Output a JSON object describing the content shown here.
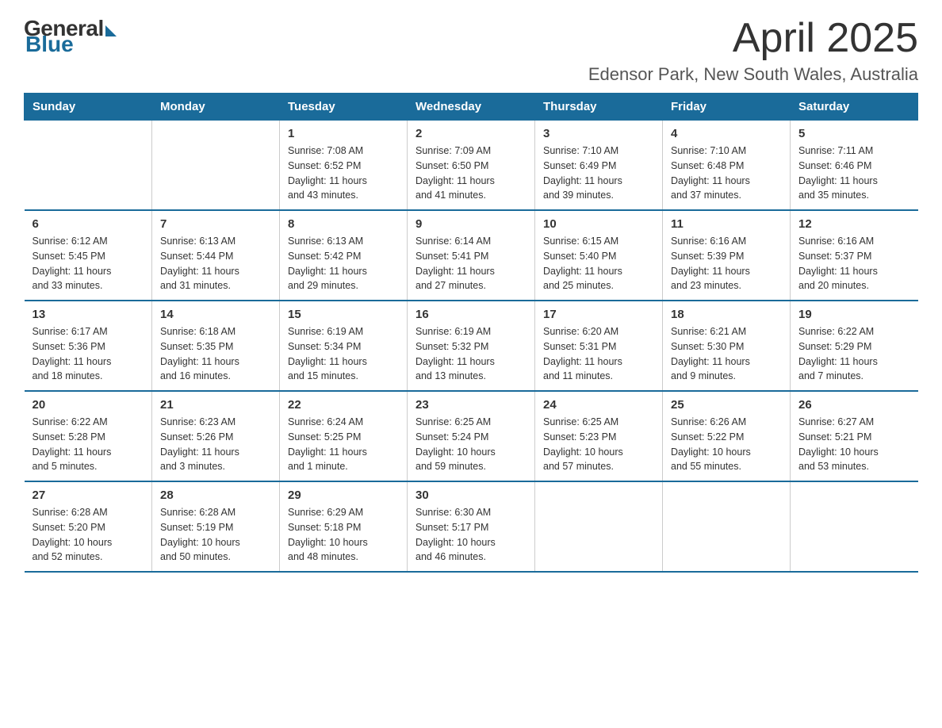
{
  "logo": {
    "general": "General",
    "blue": "Blue"
  },
  "header": {
    "month": "April 2025",
    "location": "Edensor Park, New South Wales, Australia"
  },
  "weekdays": [
    "Sunday",
    "Monday",
    "Tuesday",
    "Wednesday",
    "Thursday",
    "Friday",
    "Saturday"
  ],
  "weeks": [
    [
      {
        "day": "",
        "info": ""
      },
      {
        "day": "",
        "info": ""
      },
      {
        "day": "1",
        "info": "Sunrise: 7:08 AM\nSunset: 6:52 PM\nDaylight: 11 hours\nand 43 minutes."
      },
      {
        "day": "2",
        "info": "Sunrise: 7:09 AM\nSunset: 6:50 PM\nDaylight: 11 hours\nand 41 minutes."
      },
      {
        "day": "3",
        "info": "Sunrise: 7:10 AM\nSunset: 6:49 PM\nDaylight: 11 hours\nand 39 minutes."
      },
      {
        "day": "4",
        "info": "Sunrise: 7:10 AM\nSunset: 6:48 PM\nDaylight: 11 hours\nand 37 minutes."
      },
      {
        "day": "5",
        "info": "Sunrise: 7:11 AM\nSunset: 6:46 PM\nDaylight: 11 hours\nand 35 minutes."
      }
    ],
    [
      {
        "day": "6",
        "info": "Sunrise: 6:12 AM\nSunset: 5:45 PM\nDaylight: 11 hours\nand 33 minutes."
      },
      {
        "day": "7",
        "info": "Sunrise: 6:13 AM\nSunset: 5:44 PM\nDaylight: 11 hours\nand 31 minutes."
      },
      {
        "day": "8",
        "info": "Sunrise: 6:13 AM\nSunset: 5:42 PM\nDaylight: 11 hours\nand 29 minutes."
      },
      {
        "day": "9",
        "info": "Sunrise: 6:14 AM\nSunset: 5:41 PM\nDaylight: 11 hours\nand 27 minutes."
      },
      {
        "day": "10",
        "info": "Sunrise: 6:15 AM\nSunset: 5:40 PM\nDaylight: 11 hours\nand 25 minutes."
      },
      {
        "day": "11",
        "info": "Sunrise: 6:16 AM\nSunset: 5:39 PM\nDaylight: 11 hours\nand 23 minutes."
      },
      {
        "day": "12",
        "info": "Sunrise: 6:16 AM\nSunset: 5:37 PM\nDaylight: 11 hours\nand 20 minutes."
      }
    ],
    [
      {
        "day": "13",
        "info": "Sunrise: 6:17 AM\nSunset: 5:36 PM\nDaylight: 11 hours\nand 18 minutes."
      },
      {
        "day": "14",
        "info": "Sunrise: 6:18 AM\nSunset: 5:35 PM\nDaylight: 11 hours\nand 16 minutes."
      },
      {
        "day": "15",
        "info": "Sunrise: 6:19 AM\nSunset: 5:34 PM\nDaylight: 11 hours\nand 15 minutes."
      },
      {
        "day": "16",
        "info": "Sunrise: 6:19 AM\nSunset: 5:32 PM\nDaylight: 11 hours\nand 13 minutes."
      },
      {
        "day": "17",
        "info": "Sunrise: 6:20 AM\nSunset: 5:31 PM\nDaylight: 11 hours\nand 11 minutes."
      },
      {
        "day": "18",
        "info": "Sunrise: 6:21 AM\nSunset: 5:30 PM\nDaylight: 11 hours\nand 9 minutes."
      },
      {
        "day": "19",
        "info": "Sunrise: 6:22 AM\nSunset: 5:29 PM\nDaylight: 11 hours\nand 7 minutes."
      }
    ],
    [
      {
        "day": "20",
        "info": "Sunrise: 6:22 AM\nSunset: 5:28 PM\nDaylight: 11 hours\nand 5 minutes."
      },
      {
        "day": "21",
        "info": "Sunrise: 6:23 AM\nSunset: 5:26 PM\nDaylight: 11 hours\nand 3 minutes."
      },
      {
        "day": "22",
        "info": "Sunrise: 6:24 AM\nSunset: 5:25 PM\nDaylight: 11 hours\nand 1 minute."
      },
      {
        "day": "23",
        "info": "Sunrise: 6:25 AM\nSunset: 5:24 PM\nDaylight: 10 hours\nand 59 minutes."
      },
      {
        "day": "24",
        "info": "Sunrise: 6:25 AM\nSunset: 5:23 PM\nDaylight: 10 hours\nand 57 minutes."
      },
      {
        "day": "25",
        "info": "Sunrise: 6:26 AM\nSunset: 5:22 PM\nDaylight: 10 hours\nand 55 minutes."
      },
      {
        "day": "26",
        "info": "Sunrise: 6:27 AM\nSunset: 5:21 PM\nDaylight: 10 hours\nand 53 minutes."
      }
    ],
    [
      {
        "day": "27",
        "info": "Sunrise: 6:28 AM\nSunset: 5:20 PM\nDaylight: 10 hours\nand 52 minutes."
      },
      {
        "day": "28",
        "info": "Sunrise: 6:28 AM\nSunset: 5:19 PM\nDaylight: 10 hours\nand 50 minutes."
      },
      {
        "day": "29",
        "info": "Sunrise: 6:29 AM\nSunset: 5:18 PM\nDaylight: 10 hours\nand 48 minutes."
      },
      {
        "day": "30",
        "info": "Sunrise: 6:30 AM\nSunset: 5:17 PM\nDaylight: 10 hours\nand 46 minutes."
      },
      {
        "day": "",
        "info": ""
      },
      {
        "day": "",
        "info": ""
      },
      {
        "day": "",
        "info": ""
      }
    ]
  ]
}
